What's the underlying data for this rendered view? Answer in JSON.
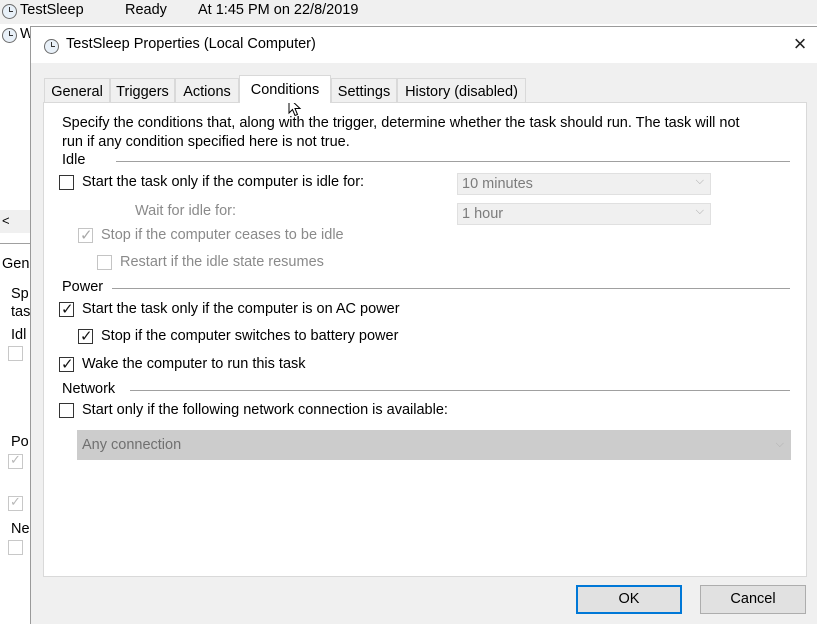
{
  "background": {
    "task_name": "TestSleep",
    "task_status": "Ready",
    "task_next_run": "At 1:45 PM on 22/8/2019",
    "second_row_partial": "W",
    "scroll_arrow": "<",
    "left_fragments": [
      "Gen",
      "Sp",
      "tas",
      "Idl",
      "Po",
      "Ne"
    ]
  },
  "dialog": {
    "title": "TestSleep Properties (Local Computer)",
    "close_glyph": "×",
    "tabs": [
      {
        "label": "General"
      },
      {
        "label": "Triggers"
      },
      {
        "label": "Actions"
      },
      {
        "label": "Conditions"
      },
      {
        "label": "Settings"
      },
      {
        "label": "History (disabled)"
      }
    ],
    "active_tab": "Conditions",
    "description_line1": "Specify the conditions that, along with the trigger, determine whether the task should run.  The task will not",
    "description_line2": "run  if any condition specified here is not true.",
    "idle": {
      "group_label": "Idle",
      "start_if_idle_label": "Start the task only if the computer is idle for:",
      "start_if_idle_checked": false,
      "idle_for_value": "10 minutes",
      "wait_label": "Wait for idle for:",
      "wait_value": "1 hour",
      "stop_if_ceases_label": "Stop if the computer ceases to be idle",
      "stop_if_ceases_checked": true,
      "restart_label": "Restart if the idle state resumes",
      "restart_checked": false
    },
    "power": {
      "group_label": "Power",
      "ac_power_label": "Start the task only if the computer is on AC power",
      "ac_power_checked": true,
      "battery_label": "Stop if the computer switches to battery power",
      "battery_checked": true,
      "wake_label": "Wake the computer to run this task",
      "wake_checked": true
    },
    "network": {
      "group_label": "Network",
      "network_label": "Start only if the following network connection is available:",
      "network_checked": false,
      "connection_value": "Any connection"
    },
    "ok_label": "OK",
    "cancel_label": "Cancel"
  },
  "colors": {
    "dialog_bg": "#f0f0f0",
    "accent": "#0078d7",
    "disabled_text": "#8a8a8a"
  }
}
